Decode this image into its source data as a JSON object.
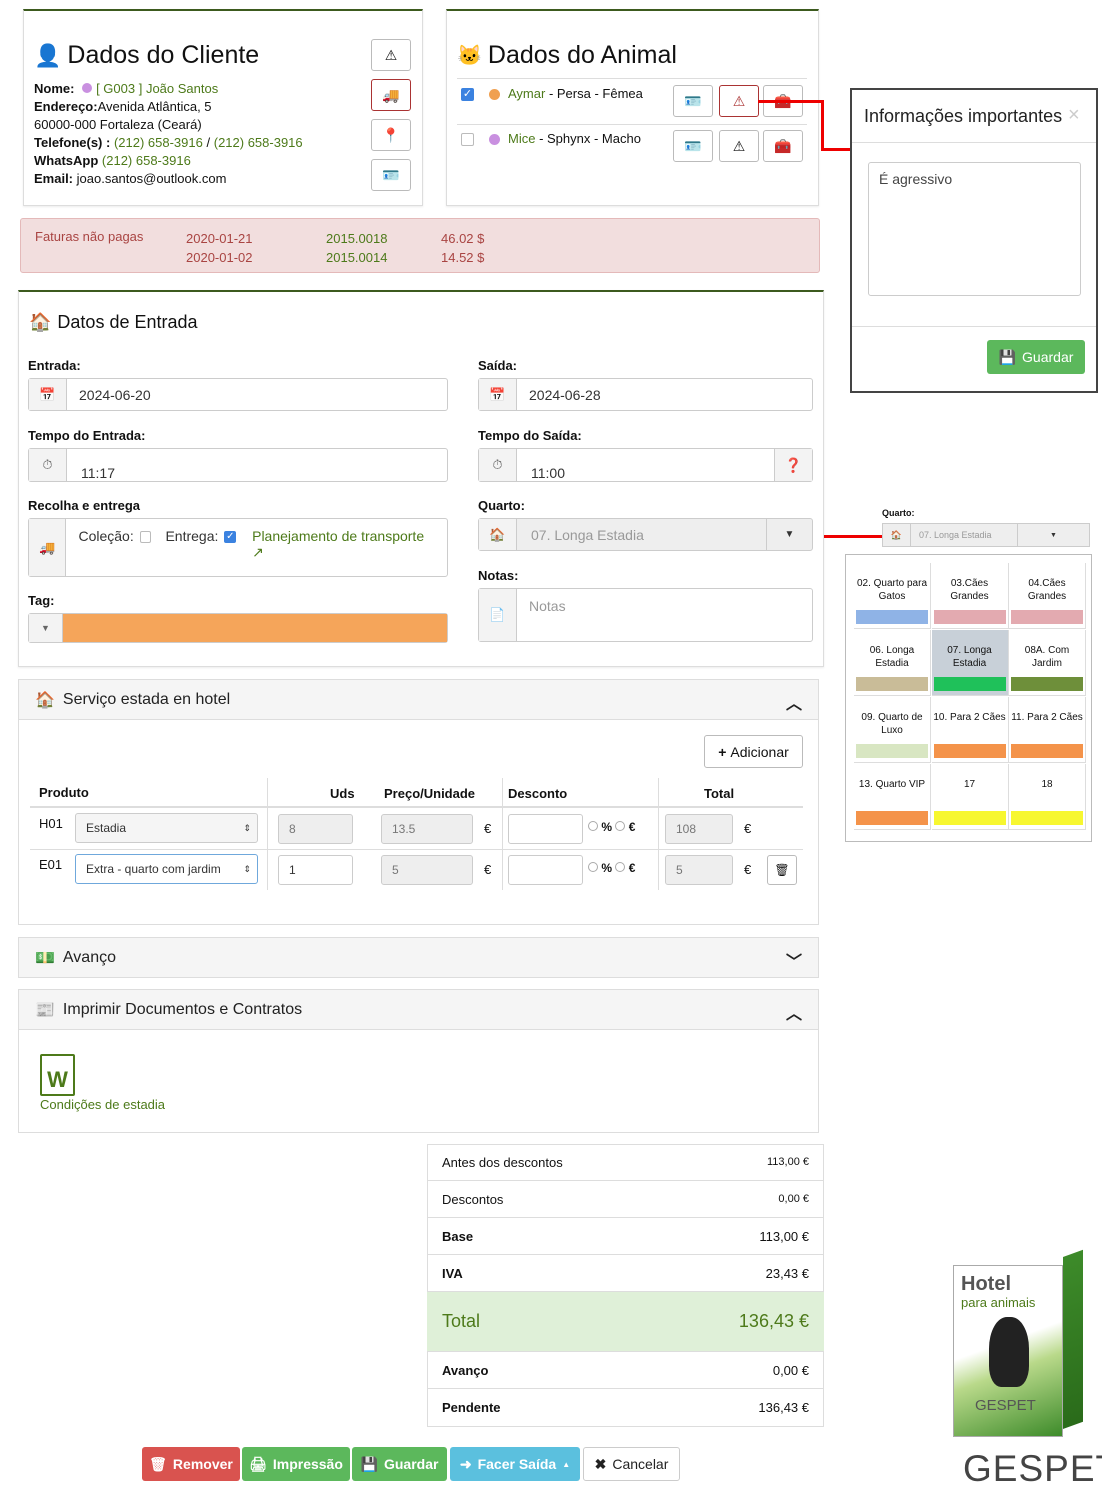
{
  "cliente": {
    "title": "Dados do Cliente",
    "nome_label": "Nome:",
    "nome_value": "[ G003 ] João Santos",
    "endereco_label": "Endereço:",
    "endereco_value": "Avenida Atlântica, 5",
    "cidade": "60000-000  Fortaleza (Ceará)",
    "telefone_label": "Telefone(s) :",
    "telefone1": "(212) 658-3916",
    "telefone_sep": "/",
    "telefone2": "(212) 658-3916",
    "whatsapp_label": "WhatsApp",
    "whatsapp_value": "(212) 658-3916",
    "email_label": "Email:",
    "email_value": "joao.santos@outlook.com"
  },
  "animal": {
    "title": "Dados do Animal",
    "rows": [
      {
        "name": "Aymar",
        "desc": " - Persa - Fêmea",
        "dot": "#f0a050",
        "checked": true
      },
      {
        "name": "Mice",
        "desc": " - Sphynx - Macho",
        "dot": "#c990e0",
        "checked": false
      }
    ]
  },
  "faturas": {
    "label": "Faturas não pagas",
    "rows": [
      {
        "date": "2020-01-21",
        "num": "2015.0018",
        "amount": "46.02 $"
      },
      {
        "date": "2020-01-02",
        "num": "2015.0014",
        "amount": "14.52 $"
      }
    ]
  },
  "entrada": {
    "title": "Datos de Entrada",
    "entrada_label": "Entrada:",
    "entrada_value": "2024-06-20",
    "saida_label": "Saída:",
    "saida_value": "2024-06-28",
    "tempo_entrada_label": "Tempo do Entrada:",
    "tempo_entrada_value": "11:17",
    "tempo_saida_label": "Tempo do Saída:",
    "tempo_saida_value": "11:00",
    "recolha_label": "Recolha e entrega",
    "colecao_label": "Coleção:",
    "entrega_label": "Entrega:",
    "planejamento": "Planejamento de transporte",
    "quarto_label": "Quarto:",
    "quarto_value": "07.  Longa Estadia",
    "notas_label": "Notas:",
    "notas_placeholder": "Notas",
    "tag_label": "Tag:",
    "tag_color": "#f5a55a"
  },
  "modal": {
    "title": "Informações importantes",
    "text": "É agressivo",
    "save": "Guardar"
  },
  "quarto_mini": {
    "label": "Quarto:",
    "value": "07. Longa Estadia"
  },
  "rooms": [
    {
      "name": "02. Quarto para Gatos",
      "color": "#8fb3e6"
    },
    {
      "name": "03.Cães Grandes",
      "color": "#e3aab0"
    },
    {
      "name": "04.Cães Grandes",
      "color": "#e3aab0"
    },
    {
      "name": "06. Longa Estadia",
      "color": "#c9bc98"
    },
    {
      "name": "07. Longa Estadia",
      "color": "#1fc15a"
    },
    {
      "name": "08A. Com Jardim",
      "color": "#6e8f3a"
    },
    {
      "name": "09. Quarto de Luxo",
      "color": "#d8e6c2"
    },
    {
      "name": "10. Para 2 Cães",
      "color": "#f4934a"
    },
    {
      "name": "11. Para 2 Cães",
      "color": "#f4934a"
    },
    {
      "name": "13. Quarto VIP",
      "color": "#f4934a"
    },
    {
      "name": "17",
      "color": "#f7f730"
    },
    {
      "name": "18",
      "color": "#f7f730"
    }
  ],
  "servico": {
    "title": "Serviço estada en hotel",
    "add": "Adicionar",
    "headers": [
      "Produto",
      "Uds",
      "Preço/Unidade",
      "Desconto",
      "Total"
    ],
    "rows": [
      {
        "code": "H01",
        "product": "Estadia",
        "uds": "8",
        "preco": "13.5",
        "cur": "€",
        "pct": "%",
        "eur": "€",
        "total": "108",
        "tcur": "€"
      },
      {
        "code": "E01",
        "product": "Extra - quarto com jardim",
        "uds": "1",
        "preco": "5",
        "cur": "€",
        "pct": "%",
        "eur": "€",
        "total": "5",
        "tcur": "€"
      }
    ]
  },
  "avanco": {
    "title": "Avanço"
  },
  "imprimir": {
    "title": "Imprimir Documentos e Contratos",
    "doc": "Condições de estadia"
  },
  "summary": [
    {
      "label": "Antes dos descontos",
      "value": "113,00 €"
    },
    {
      "label": "Descontos",
      "value": "0,00 €"
    },
    {
      "label": "Base",
      "value": "113,00 €"
    },
    {
      "label": "IVA",
      "value": "23,43 €"
    },
    {
      "label": "Total",
      "value": "136,43 €"
    },
    {
      "label": "Avanço",
      "value": "0,00 €"
    },
    {
      "label": "Pendente",
      "value": "136,43 €"
    }
  ],
  "footer": {
    "remover": "Remover",
    "impressao": "Impressão",
    "guardar": "Guardar",
    "saida": "Facer Saída",
    "cancelar": "Cancelar"
  },
  "brand": {
    "box_title": "Hotel",
    "box_sub": "para animais",
    "box_logo": "GESPET",
    "logo": "GESPET"
  }
}
